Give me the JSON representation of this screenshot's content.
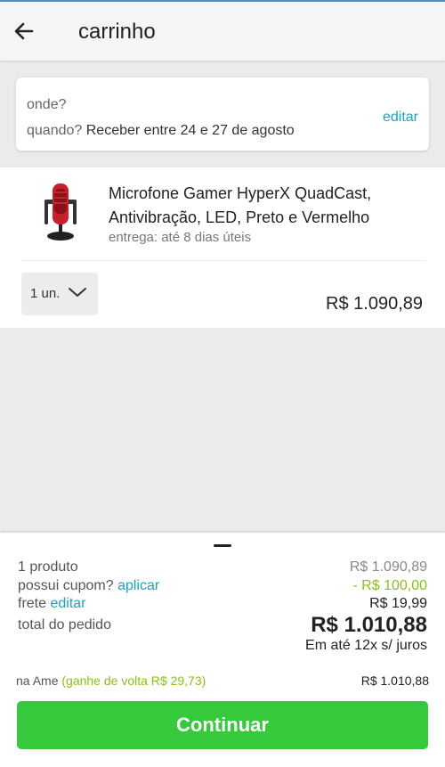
{
  "header": {
    "back_icon": "arrow-left-icon",
    "title": "carrinho"
  },
  "delivery": {
    "where_label": "onde?",
    "when_label": "quando?",
    "when_value": "Receber entre 24 e 27 de agosto",
    "edit_label": "editar"
  },
  "product": {
    "image_icon": "microphone-image",
    "name_line1": "Microfone Gamer HyperX QuadCast,",
    "name_line2": "Antivibração, LED, Preto e Vermelho",
    "delivery": "entrega: até 8 dias úteis",
    "quantity": "1 un.",
    "price": "R$ 1.090,89"
  },
  "summary": {
    "products_label": "1 produto",
    "products_value": "R$ 1.090,89",
    "coupon_label": "possui cupom?",
    "coupon_link": "aplicar",
    "coupon_value": "- R$ 100,00",
    "shipping_label": "frete",
    "shipping_link": "editar",
    "shipping_value": "R$ 19,99",
    "total_label": "total do pedido",
    "total_value": "R$ 1.010,88",
    "installments": "Em até 12x s/ juros",
    "ame_label": "na Ame",
    "ame_cashback": "(ganhe de volta R$ 29,73)",
    "ame_value": "R$ 1.010,88",
    "continue_label": "Continuar"
  },
  "colors": {
    "accent": "#1da1c4",
    "discount": "#8bbf1a",
    "cta": "#37c93c"
  }
}
